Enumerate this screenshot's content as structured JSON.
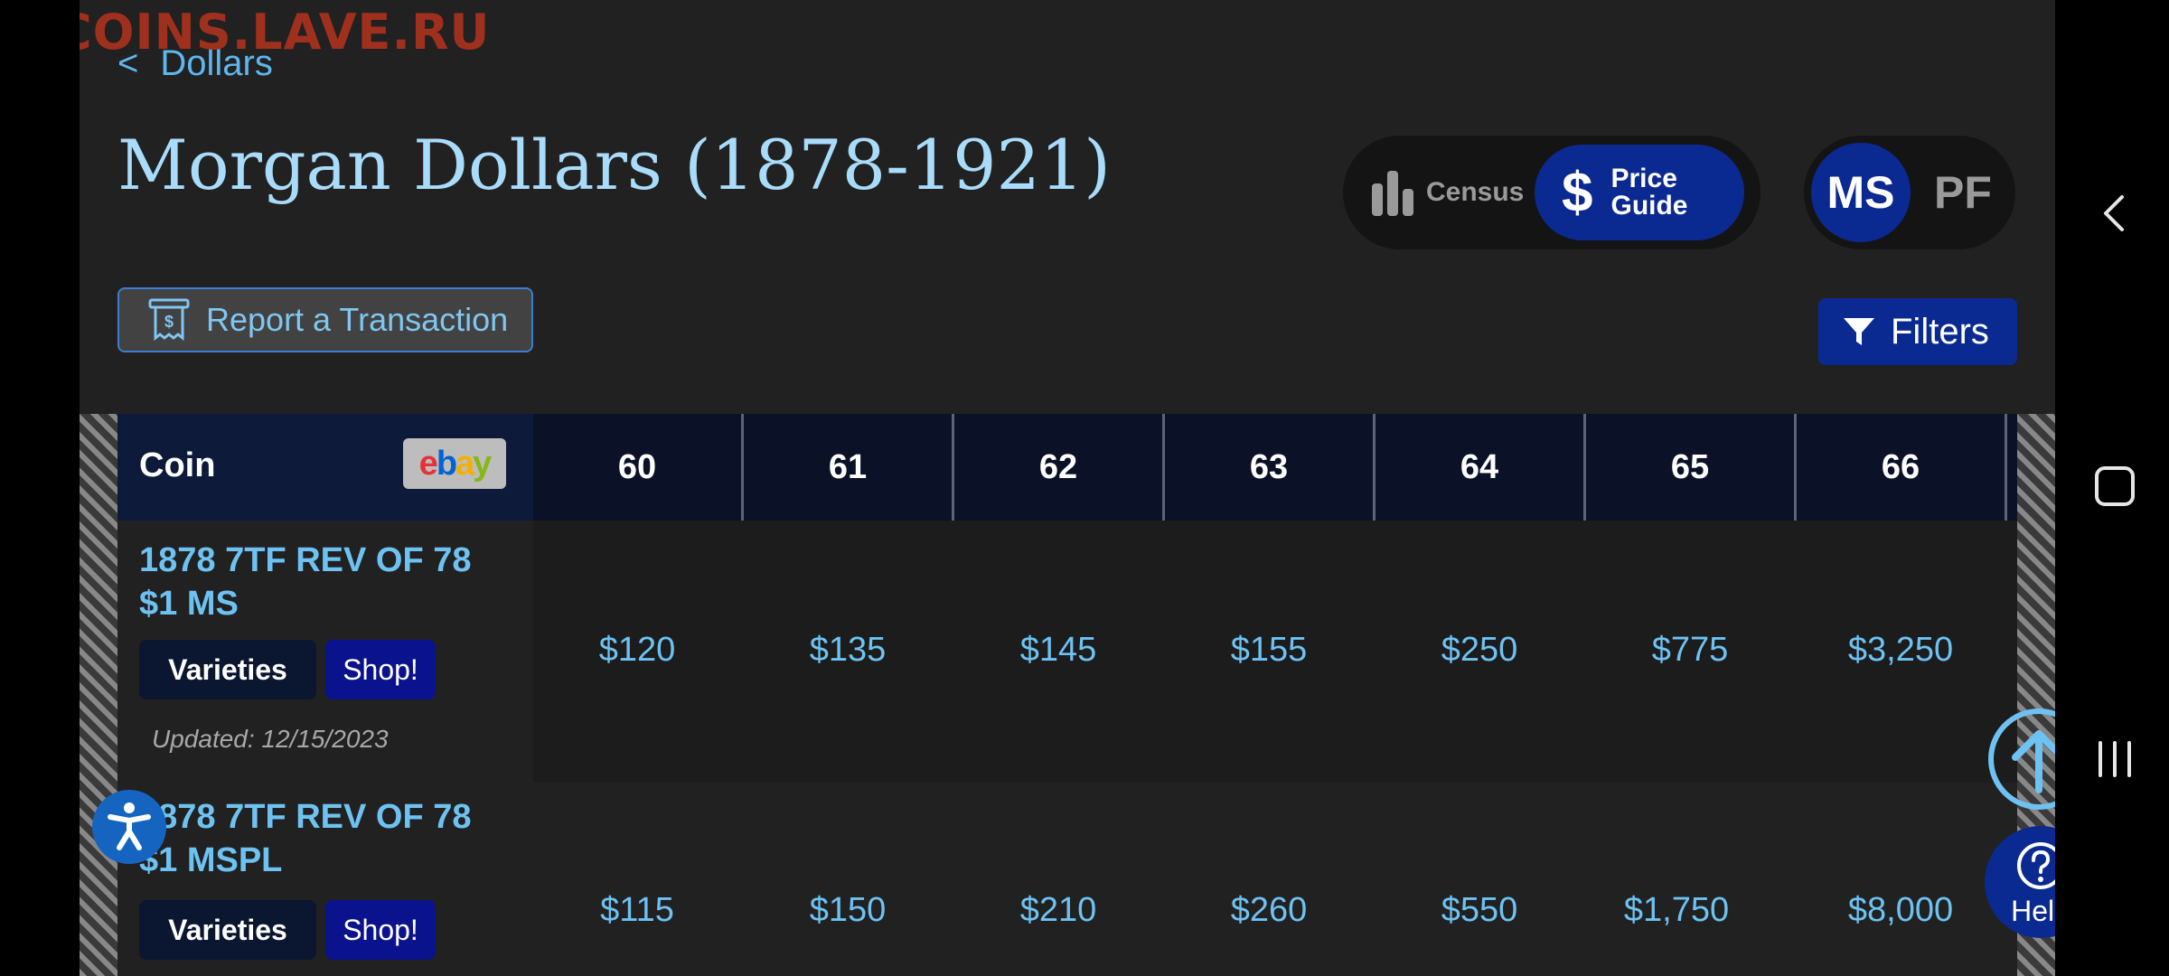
{
  "watermark": "COINS.LAVE.RU",
  "breadcrumb": {
    "chevron": "<",
    "label": "Dollars"
  },
  "page_title": "Morgan Dollars (1878-1921)",
  "mode_toggle": {
    "census_label": "Census",
    "price_guide_label_line1": "Price",
    "price_guide_label_line2": "Guide",
    "price_symbol": "$",
    "active": "Price Guide"
  },
  "grade_toggle": {
    "ms_label": "MS",
    "pf_label": "PF",
    "active": "MS"
  },
  "report_button": {
    "label": "Report a Transaction"
  },
  "filters_button": {
    "label": "Filters"
  },
  "table": {
    "coin_header": "Coin",
    "ebay_logo": {
      "e": "e",
      "b": "b",
      "a": "a",
      "y": "y"
    },
    "grades": [
      "60",
      "61",
      "62",
      "63",
      "64",
      "65",
      "66"
    ],
    "rows": [
      {
        "name_line1": "1878 7TF REV OF 78",
        "name_line2": "$1 MS",
        "varieties_label": "Varieties",
        "shop_label": "Shop!",
        "updated": "Updated: 12/15/2023",
        "prices": [
          "$120",
          "$135",
          "$145",
          "$155",
          "$250",
          "$775",
          "$3,250"
        ]
      },
      {
        "name_line1": "1878 7TF REV OF 78",
        "name_line2": "$1 MSPL",
        "varieties_label": "Varieties",
        "shop_label": "Shop!",
        "prices": [
          "$115",
          "$150",
          "$210",
          "$260",
          "$550",
          "$1,750",
          "$8,000"
        ]
      }
    ]
  },
  "help_button": {
    "label": "Help"
  },
  "colors": {
    "accent_blue": "#0b2a91",
    "link_blue": "#6ec2f2",
    "background": "#212121"
  }
}
